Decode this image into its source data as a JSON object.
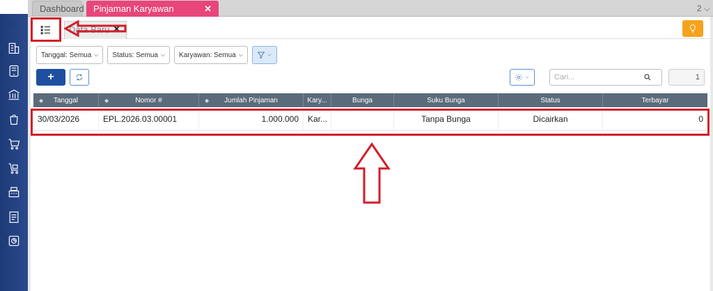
{
  "tabs": {
    "dashboard": "Dashboard",
    "active": "Pinjaman Karyawan",
    "active_close": "✕",
    "count": "2 ⌵"
  },
  "subtab": {
    "data_baru": "Data Baru",
    "close": "✕"
  },
  "filters": [
    {
      "label": "Tanggal: Semua"
    },
    {
      "label": "Status: Semua"
    },
    {
      "label": "Karyawan: Semua"
    }
  ],
  "actions": {
    "add": "+"
  },
  "search": {
    "placeholder": "Cari..."
  },
  "pagination": {
    "page": "1"
  },
  "table": {
    "columns": [
      "Tanggal",
      "Nomor #",
      "Jumlah Pinjaman",
      "Kary...",
      "Bunga",
      "Suku Bunga",
      "Status",
      "Terbayar"
    ],
    "rows": [
      [
        "30/03/2026",
        "EPL.2026.03.00001",
        "1.000.000",
        "Kar...",
        "",
        "Tanpa Bunga",
        "Dicairkan",
        "0"
      ]
    ]
  },
  "colors": {
    "sidebar": "#1e3a78",
    "active_tab": "#e8457a",
    "primary": "#1f4fa0",
    "warning": "#f7a21c",
    "annotation": "#d21d2a",
    "header": "#5b6b7c"
  },
  "icons": [
    "settings-icon",
    "building-icon",
    "tablet-icon",
    "bank-icon",
    "shopping-bag-icon",
    "cart-icon",
    "cart-box-icon",
    "cash-register-icon",
    "tax-document-icon",
    "report-icon",
    "list-icon",
    "bulb-icon",
    "filter-icon",
    "refresh-icon",
    "gear-icon",
    "search-icon"
  ]
}
